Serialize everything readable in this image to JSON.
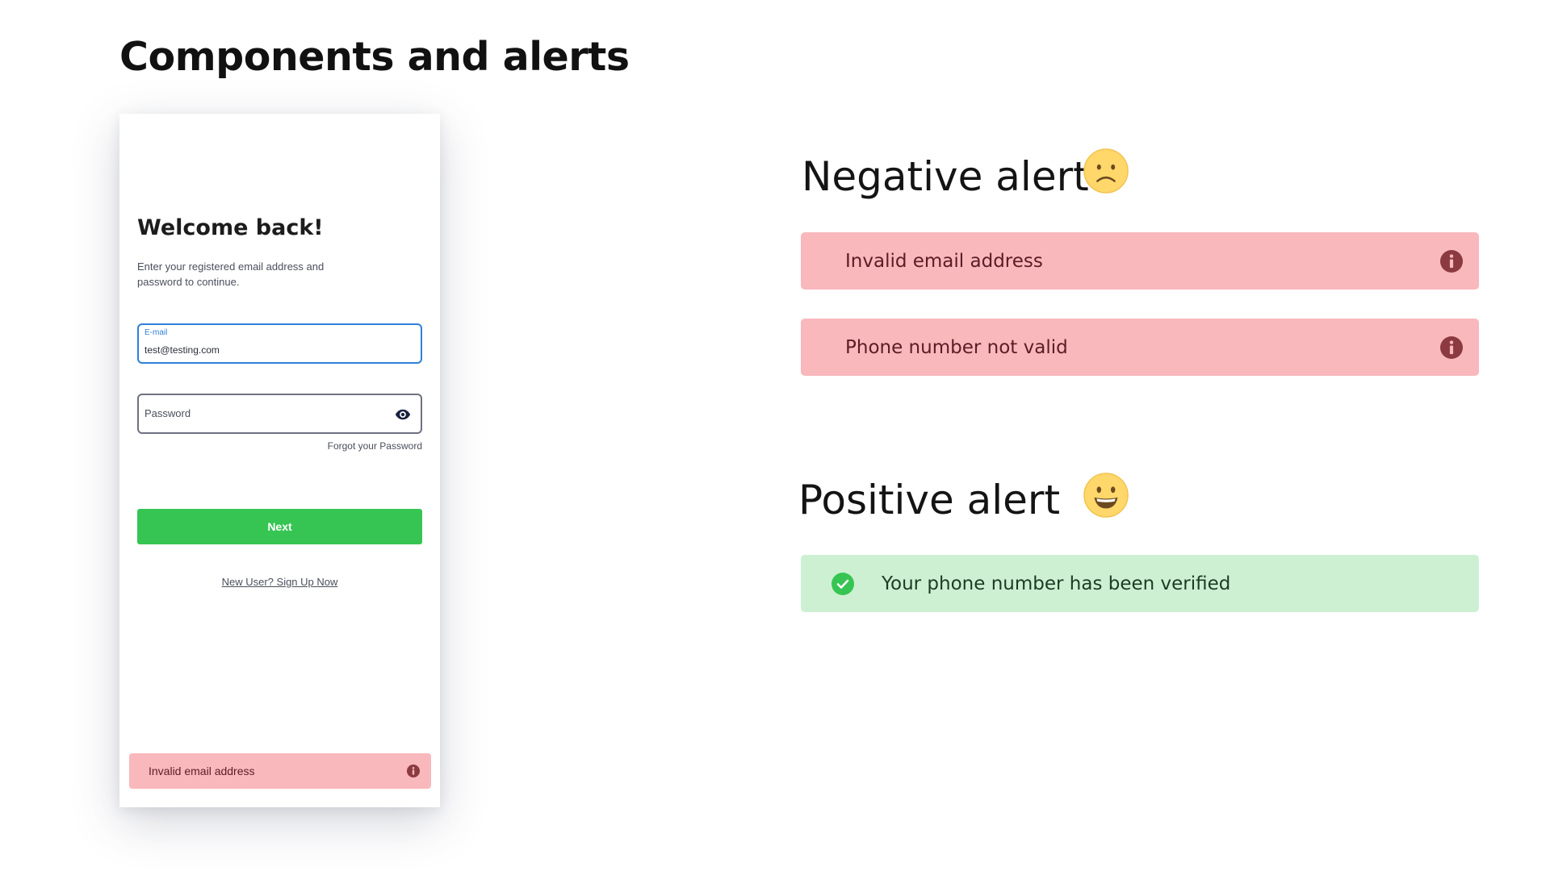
{
  "page": {
    "title": "Components and alerts"
  },
  "login": {
    "title": "Welcome back!",
    "subtitle": "Enter your registered email address and password to continue.",
    "email": {
      "label": "E-mail",
      "value": "test@testing.com"
    },
    "password": {
      "placeholder": "Password",
      "icon": "eye-icon"
    },
    "forgot_label": "Forgot your Password",
    "next_label": "Next",
    "signup_label": "New User? Sign Up Now",
    "alert": {
      "text": "Invalid email address",
      "icon": "info-icon"
    }
  },
  "negative": {
    "title": "Negative alert",
    "emoji": "sad-face-emoji",
    "alerts": [
      {
        "text": "Invalid email address",
        "icon": "info-icon"
      },
      {
        "text": "Phone number not valid",
        "icon": "info-icon"
      }
    ]
  },
  "positive": {
    "title": "Positive alert",
    "emoji": "smiling-face-emoji",
    "alerts": [
      {
        "text": "Your phone number has been verified",
        "icon": "check-circle-icon"
      }
    ]
  },
  "colors": {
    "negative_bg": "#f8b8bc",
    "negative_icon": "#8b3a3f",
    "positive_bg": "#cdf0d2",
    "positive_icon": "#36c553",
    "primary_button": "#36c553",
    "focus_border": "#2f80d8"
  }
}
